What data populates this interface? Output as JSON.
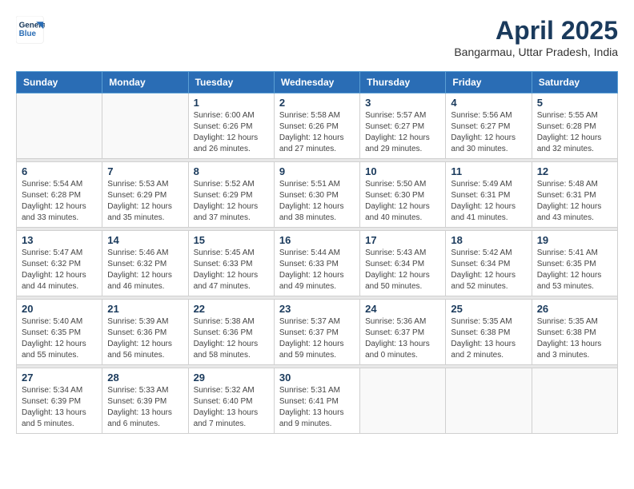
{
  "header": {
    "logo_line1": "General",
    "logo_line2": "Blue",
    "month_year": "April 2025",
    "location": "Bangarmau, Uttar Pradesh, India"
  },
  "weekdays": [
    "Sunday",
    "Monday",
    "Tuesday",
    "Wednesday",
    "Thursday",
    "Friday",
    "Saturday"
  ],
  "weeks": [
    [
      {
        "day": "",
        "sunrise": "",
        "sunset": "",
        "daylight": ""
      },
      {
        "day": "",
        "sunrise": "",
        "sunset": "",
        "daylight": ""
      },
      {
        "day": "1",
        "sunrise": "Sunrise: 6:00 AM",
        "sunset": "Sunset: 6:26 PM",
        "daylight": "Daylight: 12 hours and 26 minutes."
      },
      {
        "day": "2",
        "sunrise": "Sunrise: 5:58 AM",
        "sunset": "Sunset: 6:26 PM",
        "daylight": "Daylight: 12 hours and 27 minutes."
      },
      {
        "day": "3",
        "sunrise": "Sunrise: 5:57 AM",
        "sunset": "Sunset: 6:27 PM",
        "daylight": "Daylight: 12 hours and 29 minutes."
      },
      {
        "day": "4",
        "sunrise": "Sunrise: 5:56 AM",
        "sunset": "Sunset: 6:27 PM",
        "daylight": "Daylight: 12 hours and 30 minutes."
      },
      {
        "day": "5",
        "sunrise": "Sunrise: 5:55 AM",
        "sunset": "Sunset: 6:28 PM",
        "daylight": "Daylight: 12 hours and 32 minutes."
      }
    ],
    [
      {
        "day": "6",
        "sunrise": "Sunrise: 5:54 AM",
        "sunset": "Sunset: 6:28 PM",
        "daylight": "Daylight: 12 hours and 33 minutes."
      },
      {
        "day": "7",
        "sunrise": "Sunrise: 5:53 AM",
        "sunset": "Sunset: 6:29 PM",
        "daylight": "Daylight: 12 hours and 35 minutes."
      },
      {
        "day": "8",
        "sunrise": "Sunrise: 5:52 AM",
        "sunset": "Sunset: 6:29 PM",
        "daylight": "Daylight: 12 hours and 37 minutes."
      },
      {
        "day": "9",
        "sunrise": "Sunrise: 5:51 AM",
        "sunset": "Sunset: 6:30 PM",
        "daylight": "Daylight: 12 hours and 38 minutes."
      },
      {
        "day": "10",
        "sunrise": "Sunrise: 5:50 AM",
        "sunset": "Sunset: 6:30 PM",
        "daylight": "Daylight: 12 hours and 40 minutes."
      },
      {
        "day": "11",
        "sunrise": "Sunrise: 5:49 AM",
        "sunset": "Sunset: 6:31 PM",
        "daylight": "Daylight: 12 hours and 41 minutes."
      },
      {
        "day": "12",
        "sunrise": "Sunrise: 5:48 AM",
        "sunset": "Sunset: 6:31 PM",
        "daylight": "Daylight: 12 hours and 43 minutes."
      }
    ],
    [
      {
        "day": "13",
        "sunrise": "Sunrise: 5:47 AM",
        "sunset": "Sunset: 6:32 PM",
        "daylight": "Daylight: 12 hours and 44 minutes."
      },
      {
        "day": "14",
        "sunrise": "Sunrise: 5:46 AM",
        "sunset": "Sunset: 6:32 PM",
        "daylight": "Daylight: 12 hours and 46 minutes."
      },
      {
        "day": "15",
        "sunrise": "Sunrise: 5:45 AM",
        "sunset": "Sunset: 6:33 PM",
        "daylight": "Daylight: 12 hours and 47 minutes."
      },
      {
        "day": "16",
        "sunrise": "Sunrise: 5:44 AM",
        "sunset": "Sunset: 6:33 PM",
        "daylight": "Daylight: 12 hours and 49 minutes."
      },
      {
        "day": "17",
        "sunrise": "Sunrise: 5:43 AM",
        "sunset": "Sunset: 6:34 PM",
        "daylight": "Daylight: 12 hours and 50 minutes."
      },
      {
        "day": "18",
        "sunrise": "Sunrise: 5:42 AM",
        "sunset": "Sunset: 6:34 PM",
        "daylight": "Daylight: 12 hours and 52 minutes."
      },
      {
        "day": "19",
        "sunrise": "Sunrise: 5:41 AM",
        "sunset": "Sunset: 6:35 PM",
        "daylight": "Daylight: 12 hours and 53 minutes."
      }
    ],
    [
      {
        "day": "20",
        "sunrise": "Sunrise: 5:40 AM",
        "sunset": "Sunset: 6:35 PM",
        "daylight": "Daylight: 12 hours and 55 minutes."
      },
      {
        "day": "21",
        "sunrise": "Sunrise: 5:39 AM",
        "sunset": "Sunset: 6:36 PM",
        "daylight": "Daylight: 12 hours and 56 minutes."
      },
      {
        "day": "22",
        "sunrise": "Sunrise: 5:38 AM",
        "sunset": "Sunset: 6:36 PM",
        "daylight": "Daylight: 12 hours and 58 minutes."
      },
      {
        "day": "23",
        "sunrise": "Sunrise: 5:37 AM",
        "sunset": "Sunset: 6:37 PM",
        "daylight": "Daylight: 12 hours and 59 minutes."
      },
      {
        "day": "24",
        "sunrise": "Sunrise: 5:36 AM",
        "sunset": "Sunset: 6:37 PM",
        "daylight": "Daylight: 13 hours and 0 minutes."
      },
      {
        "day": "25",
        "sunrise": "Sunrise: 5:35 AM",
        "sunset": "Sunset: 6:38 PM",
        "daylight": "Daylight: 13 hours and 2 minutes."
      },
      {
        "day": "26",
        "sunrise": "Sunrise: 5:35 AM",
        "sunset": "Sunset: 6:38 PM",
        "daylight": "Daylight: 13 hours and 3 minutes."
      }
    ],
    [
      {
        "day": "27",
        "sunrise": "Sunrise: 5:34 AM",
        "sunset": "Sunset: 6:39 PM",
        "daylight": "Daylight: 13 hours and 5 minutes."
      },
      {
        "day": "28",
        "sunrise": "Sunrise: 5:33 AM",
        "sunset": "Sunset: 6:39 PM",
        "daylight": "Daylight: 13 hours and 6 minutes."
      },
      {
        "day": "29",
        "sunrise": "Sunrise: 5:32 AM",
        "sunset": "Sunset: 6:40 PM",
        "daylight": "Daylight: 13 hours and 7 minutes."
      },
      {
        "day": "30",
        "sunrise": "Sunrise: 5:31 AM",
        "sunset": "Sunset: 6:41 PM",
        "daylight": "Daylight: 13 hours and 9 minutes."
      },
      {
        "day": "",
        "sunrise": "",
        "sunset": "",
        "daylight": ""
      },
      {
        "day": "",
        "sunrise": "",
        "sunset": "",
        "daylight": ""
      },
      {
        "day": "",
        "sunrise": "",
        "sunset": "",
        "daylight": ""
      }
    ]
  ]
}
